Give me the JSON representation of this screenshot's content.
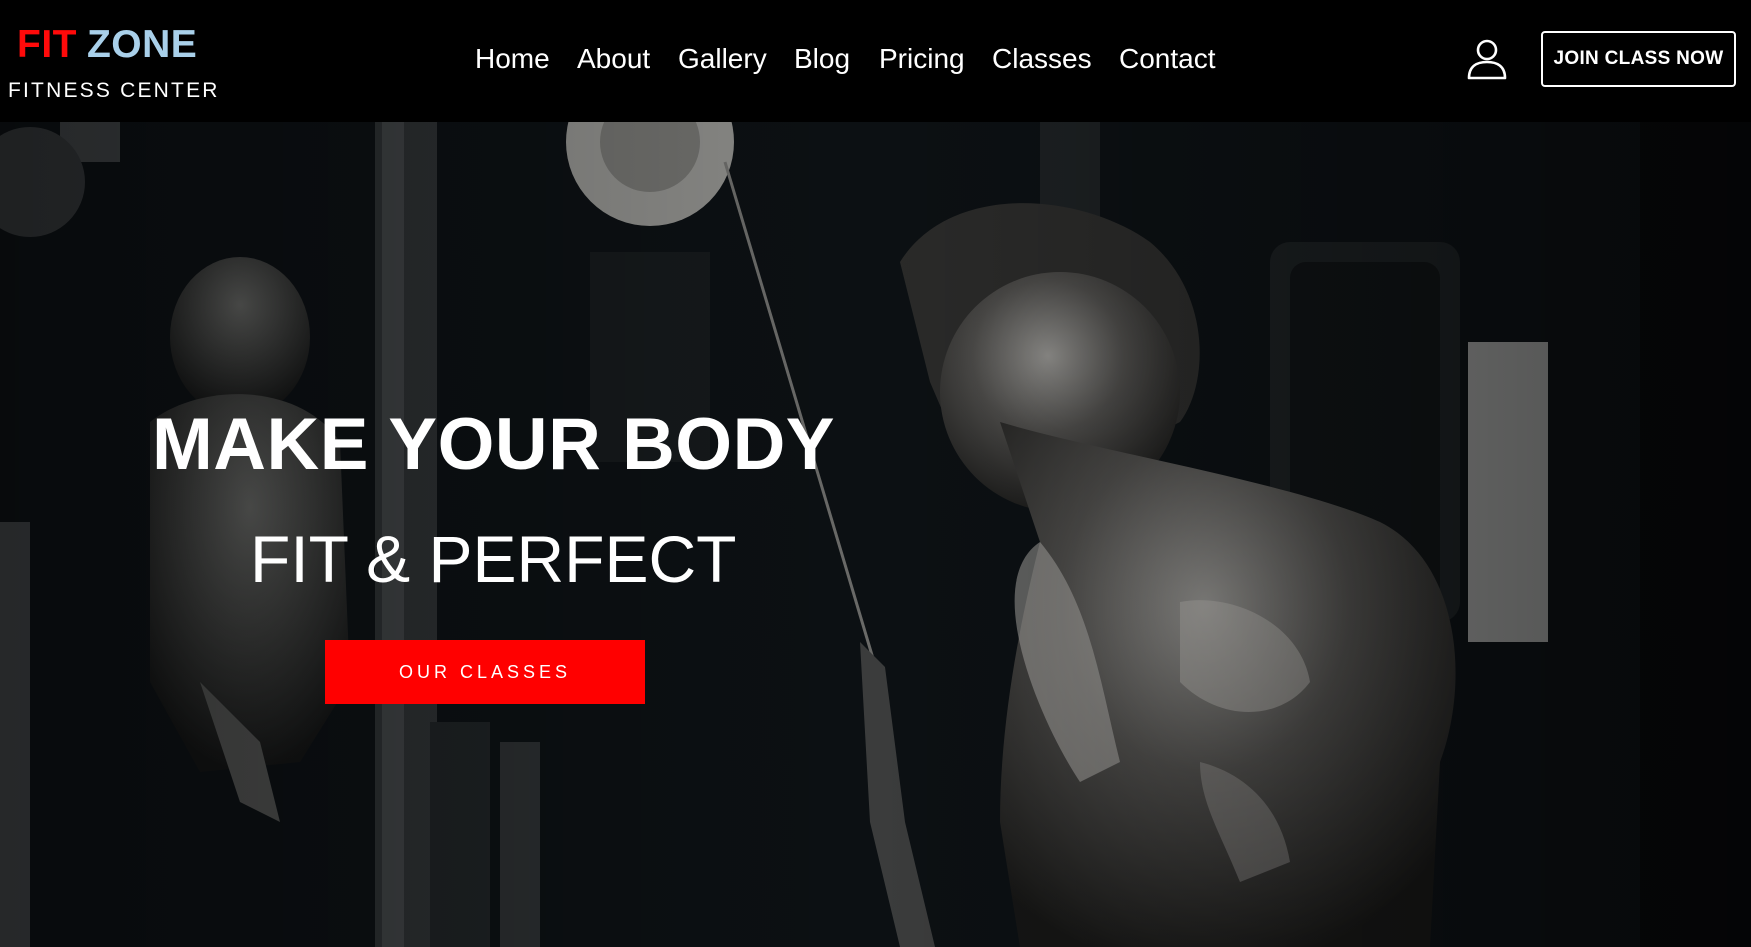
{
  "brand": {
    "name_part1": "FIT",
    "name_part2": "ZONE",
    "tagline": "FITNESS CENTER",
    "colors": {
      "part1": "#ff0a0a",
      "part2": "#a9d0ea"
    }
  },
  "nav": {
    "items": [
      {
        "label": "Home"
      },
      {
        "label": "About"
      },
      {
        "label": "Gallery"
      },
      {
        "label": "Blog"
      },
      {
        "label": "Pricing"
      },
      {
        "label": "Classes"
      },
      {
        "label": "Contact"
      }
    ]
  },
  "header": {
    "user_icon": "user-icon",
    "join_label": "JOIN CLASS NOW"
  },
  "hero": {
    "title": "MAKE YOUR BODY",
    "subtitle": "FIT & PERFECT",
    "cta_label": "OUR CLASSES",
    "cta_color": "#ff0000"
  }
}
